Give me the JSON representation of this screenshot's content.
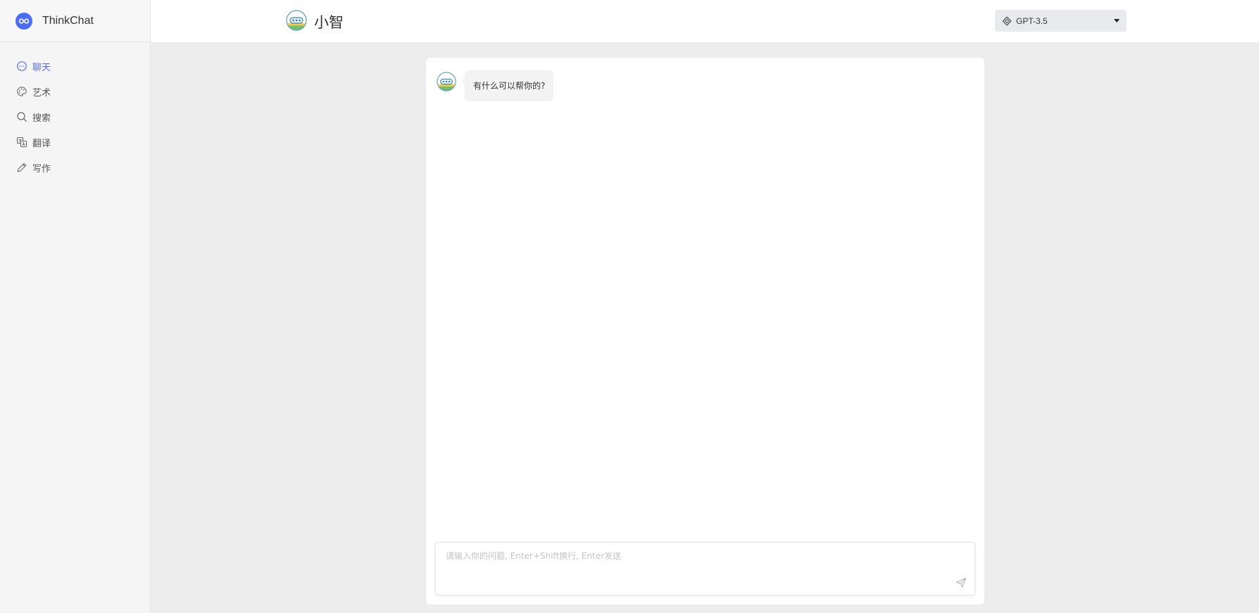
{
  "sidebar": {
    "brand": {
      "name": "ThinkChat",
      "logo": "infinity-logo-icon"
    },
    "items": [
      {
        "label": "聊天",
        "icon": "chat-bubble-icon",
        "active": true
      },
      {
        "label": "艺术",
        "icon": "palette-icon",
        "active": false
      },
      {
        "label": "搜索",
        "icon": "search-icon",
        "active": false
      },
      {
        "label": "翻译",
        "icon": "translate-icon",
        "active": false
      },
      {
        "label": "写作",
        "icon": "pen-icon",
        "active": false
      }
    ]
  },
  "header": {
    "bot_name": "小智",
    "bot_avatar": "robot-avatar-icon",
    "model": {
      "selected": "GPT-3.5",
      "icon": "diamond-icon"
    }
  },
  "chat": {
    "messages": [
      {
        "role": "bot",
        "text": "有什么可以帮你的?"
      }
    ],
    "input": {
      "value": "",
      "placeholder": "请输入你的问题, Enter+Shift换行, Enter发送"
    }
  },
  "colors": {
    "accent": "#5b6ee1",
    "brand_logo": "#4a6cf7",
    "sidebar_bg": "#f5f5f5",
    "page_bg": "#ededed"
  }
}
